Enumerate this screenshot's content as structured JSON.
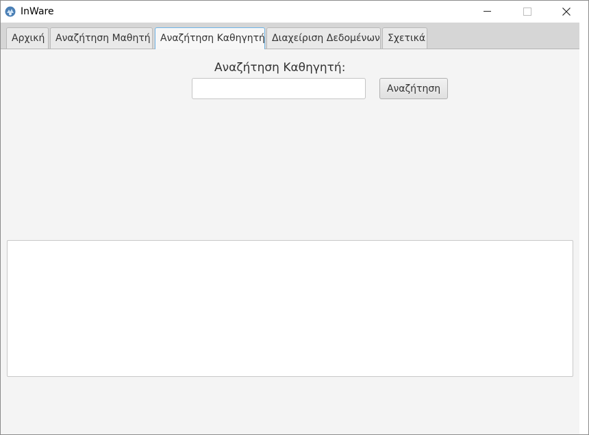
{
  "window": {
    "title": "InWare",
    "icon": "app-logo-icon"
  },
  "titlebar_buttons": {
    "minimize_icon": "minimize-icon",
    "maximize_icon": "maximize-icon",
    "close_icon": "close-icon"
  },
  "tabs": [
    {
      "label": "Αρχική",
      "selected": false
    },
    {
      "label": "Αναζήτηση Μαθητή",
      "selected": false
    },
    {
      "label": "Αναζήτηση Καθηγητή",
      "selected": true
    },
    {
      "label": "Διαχείριση Δεδομένων",
      "selected": false
    },
    {
      "label": "Σχετικά",
      "selected": false
    }
  ],
  "search": {
    "label": "Αναζήτηση Καθηγητή:",
    "value": "",
    "button_label": "Αναζήτηση"
  },
  "results": {
    "text": ""
  },
  "colors": {
    "selected_tab_border": "#6db4e6",
    "background": "#f4f4f4"
  }
}
